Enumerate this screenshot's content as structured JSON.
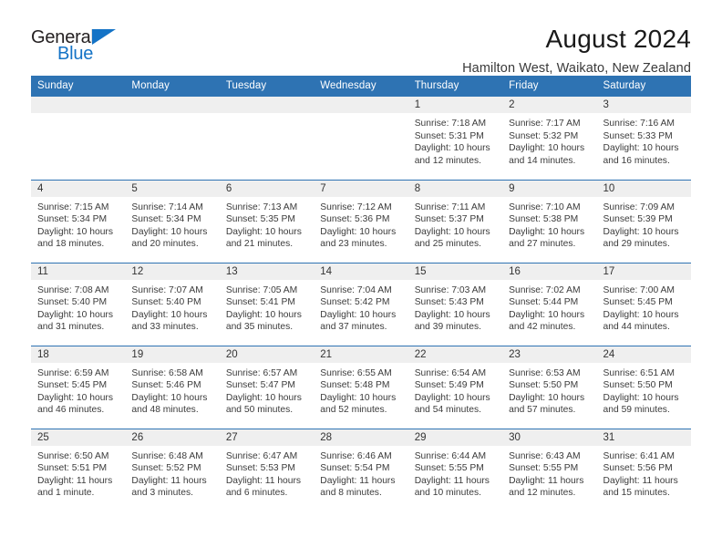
{
  "brand": {
    "word1": "General",
    "word2": "Blue",
    "triangle_color": "#1473c6",
    "text_color": "#231f20"
  },
  "header": {
    "title": "August 2024",
    "subtitle": "Hamilton West, Waikato, New Zealand"
  },
  "theme": {
    "header_blue": "#2e73b3",
    "daynum_gray": "#efefef",
    "text": "#3b3b3b"
  },
  "weekday_headers": [
    "Sunday",
    "Monday",
    "Tuesday",
    "Wednesday",
    "Thursday",
    "Friday",
    "Saturday"
  ],
  "labels": {
    "sunrise": "Sunrise:",
    "sunset": "Sunset:",
    "daylight": "Daylight:"
  },
  "weeks": [
    [
      {
        "day": "",
        "empty": true,
        "sunrise": "",
        "sunset": "",
        "daylight_1": "",
        "daylight_2": ""
      },
      {
        "day": "",
        "empty": true,
        "sunrise": "",
        "sunset": "",
        "daylight_1": "",
        "daylight_2": ""
      },
      {
        "day": "",
        "empty": true,
        "sunrise": "",
        "sunset": "",
        "daylight_1": "",
        "daylight_2": ""
      },
      {
        "day": "",
        "empty": true,
        "sunrise": "",
        "sunset": "",
        "daylight_1": "",
        "daylight_2": ""
      },
      {
        "day": "1",
        "empty": false,
        "sunrise": "Sunrise: 7:18 AM",
        "sunset": "Sunset: 5:31 PM",
        "daylight_1": "Daylight: 10 hours",
        "daylight_2": "and 12 minutes."
      },
      {
        "day": "2",
        "empty": false,
        "sunrise": "Sunrise: 7:17 AM",
        "sunset": "Sunset: 5:32 PM",
        "daylight_1": "Daylight: 10 hours",
        "daylight_2": "and 14 minutes."
      },
      {
        "day": "3",
        "empty": false,
        "sunrise": "Sunrise: 7:16 AM",
        "sunset": "Sunset: 5:33 PM",
        "daylight_1": "Daylight: 10 hours",
        "daylight_2": "and 16 minutes."
      }
    ],
    [
      {
        "day": "4",
        "empty": false,
        "sunrise": "Sunrise: 7:15 AM",
        "sunset": "Sunset: 5:34 PM",
        "daylight_1": "Daylight: 10 hours",
        "daylight_2": "and 18 minutes."
      },
      {
        "day": "5",
        "empty": false,
        "sunrise": "Sunrise: 7:14 AM",
        "sunset": "Sunset: 5:34 PM",
        "daylight_1": "Daylight: 10 hours",
        "daylight_2": "and 20 minutes."
      },
      {
        "day": "6",
        "empty": false,
        "sunrise": "Sunrise: 7:13 AM",
        "sunset": "Sunset: 5:35 PM",
        "daylight_1": "Daylight: 10 hours",
        "daylight_2": "and 21 minutes."
      },
      {
        "day": "7",
        "empty": false,
        "sunrise": "Sunrise: 7:12 AM",
        "sunset": "Sunset: 5:36 PM",
        "daylight_1": "Daylight: 10 hours",
        "daylight_2": "and 23 minutes."
      },
      {
        "day": "8",
        "empty": false,
        "sunrise": "Sunrise: 7:11 AM",
        "sunset": "Sunset: 5:37 PM",
        "daylight_1": "Daylight: 10 hours",
        "daylight_2": "and 25 minutes."
      },
      {
        "day": "9",
        "empty": false,
        "sunrise": "Sunrise: 7:10 AM",
        "sunset": "Sunset: 5:38 PM",
        "daylight_1": "Daylight: 10 hours",
        "daylight_2": "and 27 minutes."
      },
      {
        "day": "10",
        "empty": false,
        "sunrise": "Sunrise: 7:09 AM",
        "sunset": "Sunset: 5:39 PM",
        "daylight_1": "Daylight: 10 hours",
        "daylight_2": "and 29 minutes."
      }
    ],
    [
      {
        "day": "11",
        "empty": false,
        "sunrise": "Sunrise: 7:08 AM",
        "sunset": "Sunset: 5:40 PM",
        "daylight_1": "Daylight: 10 hours",
        "daylight_2": "and 31 minutes."
      },
      {
        "day": "12",
        "empty": false,
        "sunrise": "Sunrise: 7:07 AM",
        "sunset": "Sunset: 5:40 PM",
        "daylight_1": "Daylight: 10 hours",
        "daylight_2": "and 33 minutes."
      },
      {
        "day": "13",
        "empty": false,
        "sunrise": "Sunrise: 7:05 AM",
        "sunset": "Sunset: 5:41 PM",
        "daylight_1": "Daylight: 10 hours",
        "daylight_2": "and 35 minutes."
      },
      {
        "day": "14",
        "empty": false,
        "sunrise": "Sunrise: 7:04 AM",
        "sunset": "Sunset: 5:42 PM",
        "daylight_1": "Daylight: 10 hours",
        "daylight_2": "and 37 minutes."
      },
      {
        "day": "15",
        "empty": false,
        "sunrise": "Sunrise: 7:03 AM",
        "sunset": "Sunset: 5:43 PM",
        "daylight_1": "Daylight: 10 hours",
        "daylight_2": "and 39 minutes."
      },
      {
        "day": "16",
        "empty": false,
        "sunrise": "Sunrise: 7:02 AM",
        "sunset": "Sunset: 5:44 PM",
        "daylight_1": "Daylight: 10 hours",
        "daylight_2": "and 42 minutes."
      },
      {
        "day": "17",
        "empty": false,
        "sunrise": "Sunrise: 7:00 AM",
        "sunset": "Sunset: 5:45 PM",
        "daylight_1": "Daylight: 10 hours",
        "daylight_2": "and 44 minutes."
      }
    ],
    [
      {
        "day": "18",
        "empty": false,
        "sunrise": "Sunrise: 6:59 AM",
        "sunset": "Sunset: 5:45 PM",
        "daylight_1": "Daylight: 10 hours",
        "daylight_2": "and 46 minutes."
      },
      {
        "day": "19",
        "empty": false,
        "sunrise": "Sunrise: 6:58 AM",
        "sunset": "Sunset: 5:46 PM",
        "daylight_1": "Daylight: 10 hours",
        "daylight_2": "and 48 minutes."
      },
      {
        "day": "20",
        "empty": false,
        "sunrise": "Sunrise: 6:57 AM",
        "sunset": "Sunset: 5:47 PM",
        "daylight_1": "Daylight: 10 hours",
        "daylight_2": "and 50 minutes."
      },
      {
        "day": "21",
        "empty": false,
        "sunrise": "Sunrise: 6:55 AM",
        "sunset": "Sunset: 5:48 PM",
        "daylight_1": "Daylight: 10 hours",
        "daylight_2": "and 52 minutes."
      },
      {
        "day": "22",
        "empty": false,
        "sunrise": "Sunrise: 6:54 AM",
        "sunset": "Sunset: 5:49 PM",
        "daylight_1": "Daylight: 10 hours",
        "daylight_2": "and 54 minutes."
      },
      {
        "day": "23",
        "empty": false,
        "sunrise": "Sunrise: 6:53 AM",
        "sunset": "Sunset: 5:50 PM",
        "daylight_1": "Daylight: 10 hours",
        "daylight_2": "and 57 minutes."
      },
      {
        "day": "24",
        "empty": false,
        "sunrise": "Sunrise: 6:51 AM",
        "sunset": "Sunset: 5:50 PM",
        "daylight_1": "Daylight: 10 hours",
        "daylight_2": "and 59 minutes."
      }
    ],
    [
      {
        "day": "25",
        "empty": false,
        "sunrise": "Sunrise: 6:50 AM",
        "sunset": "Sunset: 5:51 PM",
        "daylight_1": "Daylight: 11 hours",
        "daylight_2": "and 1 minute."
      },
      {
        "day": "26",
        "empty": false,
        "sunrise": "Sunrise: 6:48 AM",
        "sunset": "Sunset: 5:52 PM",
        "daylight_1": "Daylight: 11 hours",
        "daylight_2": "and 3 minutes."
      },
      {
        "day": "27",
        "empty": false,
        "sunrise": "Sunrise: 6:47 AM",
        "sunset": "Sunset: 5:53 PM",
        "daylight_1": "Daylight: 11 hours",
        "daylight_2": "and 6 minutes."
      },
      {
        "day": "28",
        "empty": false,
        "sunrise": "Sunrise: 6:46 AM",
        "sunset": "Sunset: 5:54 PM",
        "daylight_1": "Daylight: 11 hours",
        "daylight_2": "and 8 minutes."
      },
      {
        "day": "29",
        "empty": false,
        "sunrise": "Sunrise: 6:44 AM",
        "sunset": "Sunset: 5:55 PM",
        "daylight_1": "Daylight: 11 hours",
        "daylight_2": "and 10 minutes."
      },
      {
        "day": "30",
        "empty": false,
        "sunrise": "Sunrise: 6:43 AM",
        "sunset": "Sunset: 5:55 PM",
        "daylight_1": "Daylight: 11 hours",
        "daylight_2": "and 12 minutes."
      },
      {
        "day": "31",
        "empty": false,
        "sunrise": "Sunrise: 6:41 AM",
        "sunset": "Sunset: 5:56 PM",
        "daylight_1": "Daylight: 11 hours",
        "daylight_2": "and 15 minutes."
      }
    ]
  ]
}
